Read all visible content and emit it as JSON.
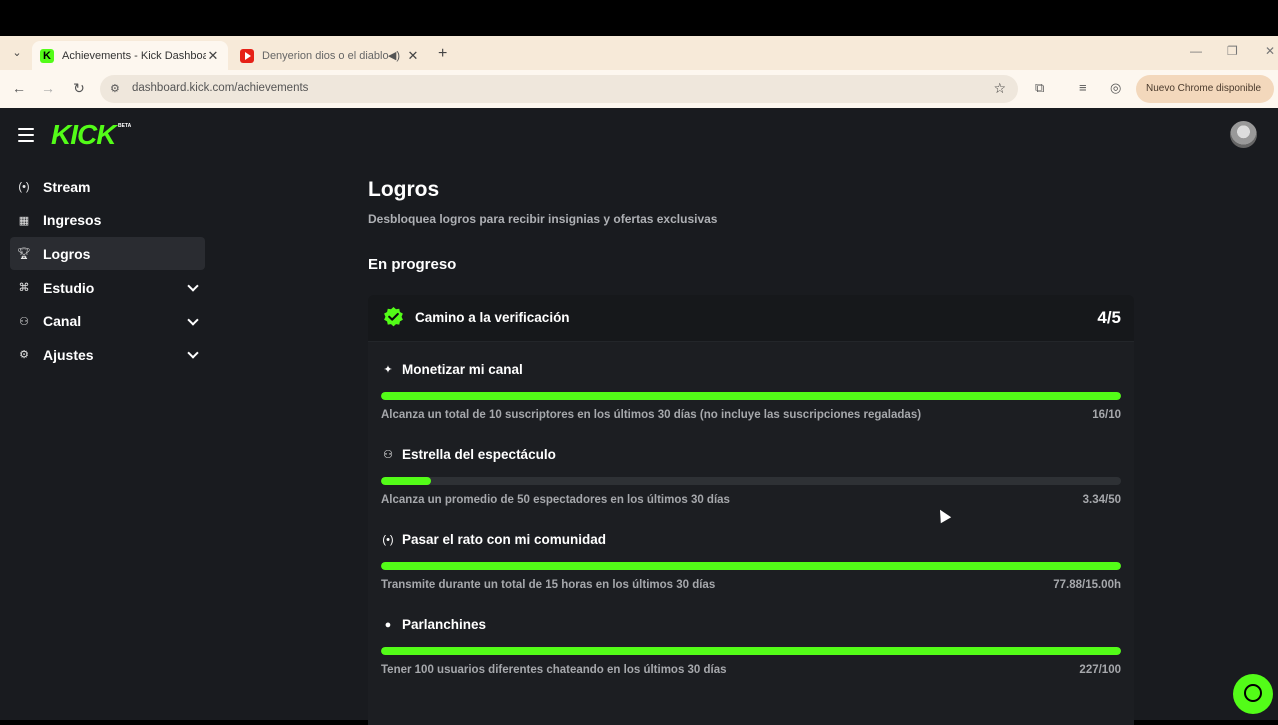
{
  "browser": {
    "tabs": [
      {
        "title": "Achievements - Kick Dashboard",
        "active": true
      },
      {
        "title": "Denyerion dios o el diablo",
        "active": false
      }
    ],
    "url": "dashboard.kick.com/achievements",
    "update_button": "Nuevo Chrome disponible"
  },
  "header": {
    "logo": "KICK",
    "logo_tag": "BETA"
  },
  "sidebar": {
    "items": [
      {
        "label": "Stream",
        "icon": "broadcast-icon"
      },
      {
        "label": "Ingresos",
        "icon": "chart-icon"
      },
      {
        "label": "Logros",
        "icon": "trophy-icon",
        "active": true
      },
      {
        "label": "Estudio",
        "icon": "studio-icon",
        "expandable": true
      },
      {
        "label": "Canal",
        "icon": "users-icon",
        "expandable": true
      },
      {
        "label": "Ajustes",
        "icon": "gear-icon",
        "expandable": true
      }
    ]
  },
  "main": {
    "title": "Logros",
    "subtitle": "Desbloquea logros para recibir insignias y ofertas exclusivas",
    "section": "En progreso",
    "card": {
      "title": "Camino a la verificación",
      "count": "4/5",
      "achievements": [
        {
          "name": "Monetizar mi canal",
          "icon": "sparkle-icon",
          "desc": "Alcanza un total de 10 suscriptores en los últimos 30 días (no incluye las suscripciones regaladas)",
          "progress": "16/10",
          "fill": 1.0
        },
        {
          "name": "Estrella del espectáculo",
          "icon": "users-icon",
          "desc": "Alcanza un promedio de 50 espectadores en los últimos 30 días",
          "progress": "3.34/50",
          "fill": 0.067
        },
        {
          "name": "Pasar el rato con mi comunidad",
          "icon": "broadcast-icon",
          "desc": "Transmite durante un total de 15 horas en los últimos 30 días",
          "progress": "77.88/15.00h",
          "fill": 1.0
        },
        {
          "name": "Parlanchines",
          "icon": "chat-icon",
          "desc": "Tener 100 usuarios diferentes chateando en los últimos 30 días",
          "progress": "227/100",
          "fill": 1.0
        }
      ]
    }
  },
  "colors": {
    "accent": "#53fc18",
    "background": "#191b1f"
  }
}
